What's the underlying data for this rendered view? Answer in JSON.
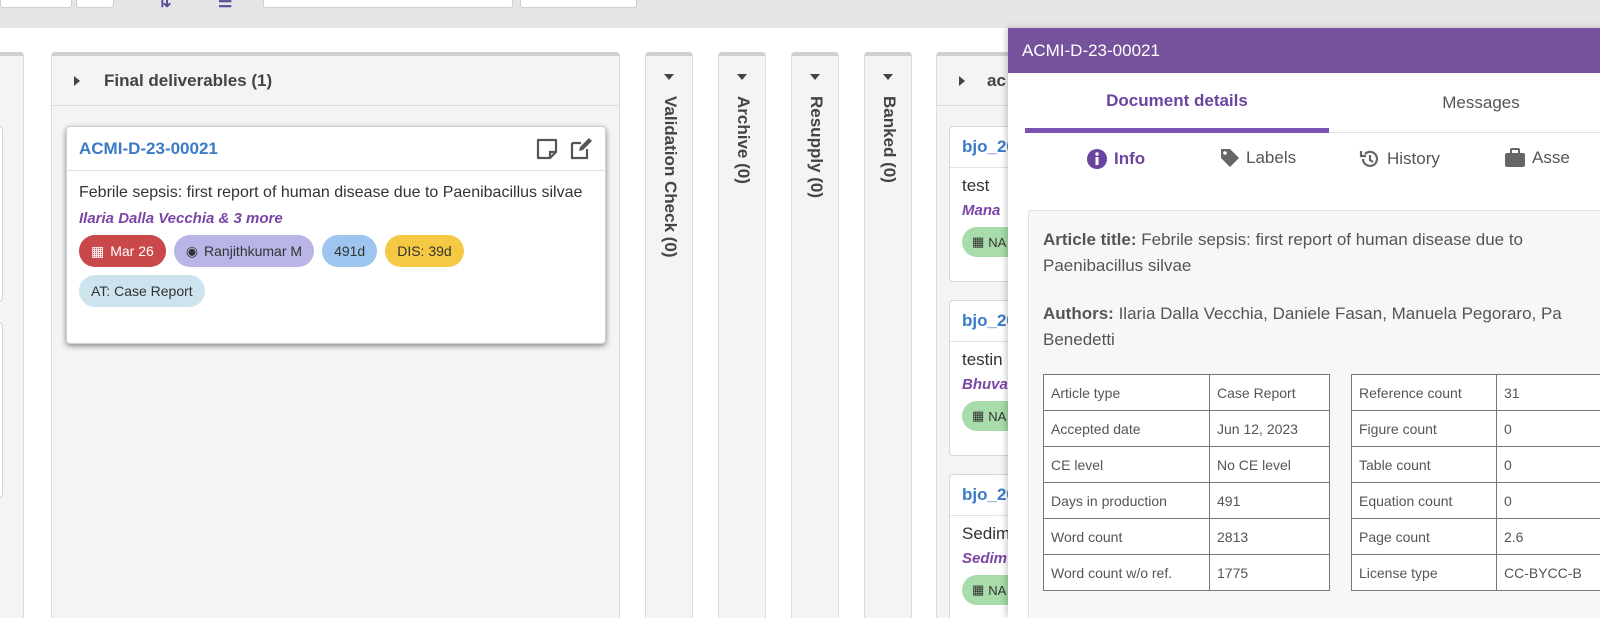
{
  "final_column": {
    "title": "Final deliverables (1)",
    "card": {
      "id": "ACMI-D-23-00021",
      "title": "Febrile sepsis: first report of human disease due to Paenibacillus silvae",
      "authors": "Ilaria Dalla Vecchia & 3 more",
      "badges": {
        "date": "Mar 26",
        "assignee": "Ranjithkumar M",
        "days": "491d",
        "dis": "DIS: 39d",
        "article_type": "AT: Case Report"
      },
      "colors": {
        "date": "#c9484a",
        "assignee": "#b9b5e6",
        "days": "#9dc5ef",
        "dis": "#f6c945",
        "article_type": "#cde4ef"
      }
    }
  },
  "vertical_columns": [
    "Validation Check (0)",
    "Archive (0)",
    "Resupply (0)",
    "Banked (0)"
  ],
  "partial_column": {
    "title": "ac",
    "cards": [
      {
        "id": "bjo_20",
        "title": "test",
        "author": "Mana",
        "badge": "NA"
      },
      {
        "id": "bjo_20",
        "title": "testin",
        "author": "Bhuva",
        "badge": "NA"
      },
      {
        "id": "bjo_20",
        "title": "Sedim",
        "author": "Sedim",
        "badge": "NA"
      }
    ]
  },
  "panel": {
    "header": "ACMI-D-23-00021",
    "tabs": {
      "details": "Document details",
      "messages": "Messages"
    },
    "subtabs": {
      "info": "Info",
      "labels": "Labels",
      "history": "History",
      "assets": "Asse"
    },
    "article_title_label": "Article title:",
    "article_title": "Febrile sepsis: first report of human disease due to Paenibacillus silvae",
    "authors_label": "Authors:",
    "authors": "Ilaria Dalla Vecchia, Daniele Fasan, Manuela Pegoraro, Pa",
    "authors_line2": "Benedetti",
    "left_table": [
      [
        "Article type",
        "Case Report"
      ],
      [
        "Accepted date",
        "Jun 12, 2023"
      ],
      [
        "CE level",
        "No CE level"
      ],
      [
        "Days in production",
        "491"
      ],
      [
        "Word count",
        "2813"
      ],
      [
        "Word count w/o ref.",
        "1775"
      ]
    ],
    "right_table": [
      [
        "Reference count",
        "31"
      ],
      [
        "Figure count",
        "0"
      ],
      [
        "Table count",
        "0"
      ],
      [
        "Equation count",
        "0"
      ],
      [
        "Page count",
        "2.6"
      ],
      [
        "License type",
        "CC-BYCC-B"
      ]
    ]
  }
}
